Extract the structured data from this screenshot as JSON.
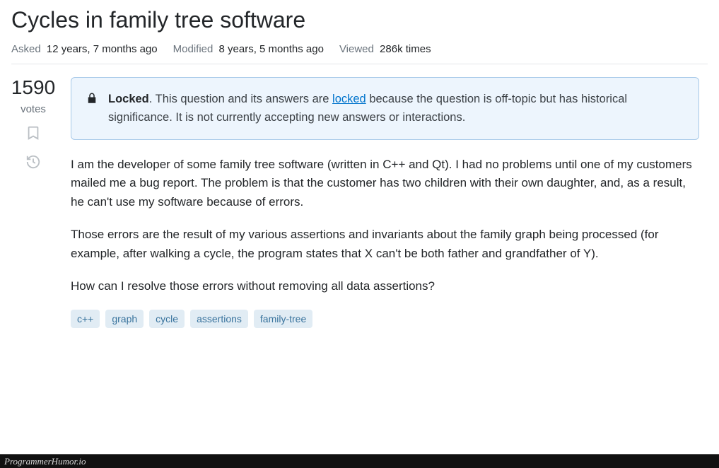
{
  "question": {
    "title": "Cycles in family tree software",
    "meta": {
      "asked_label": "Asked",
      "asked_value": "12 years, 7 months ago",
      "modified_label": "Modified",
      "modified_value": "8 years, 5 months ago",
      "viewed_label": "Viewed",
      "viewed_value": "286k times"
    },
    "votes": {
      "count": "1590",
      "label": "votes"
    },
    "notice": {
      "strong": "Locked",
      "prefix": ". This question and its answers are ",
      "link": "locked",
      "suffix": " because the question is off-topic but has historical significance. It is not currently accepting new answers or interactions."
    },
    "body": {
      "p1": "I am the developer of some family tree software (written in C++ and Qt). I had no problems until one of my customers mailed me a bug report. The problem is that the customer has two children with their own daughter, and, as a result, he can't use my software because of errors.",
      "p2": "Those errors are the result of my various assertions and invariants about the family graph being processed (for example, after walking a cycle, the program states that X can't be both father and grandfather of Y).",
      "p3": "How can I resolve those errors without removing all data assertions?"
    },
    "tags": [
      "c++",
      "graph",
      "cycle",
      "assertions",
      "family-tree"
    ]
  },
  "footer": "ProgrammerHumor.io"
}
